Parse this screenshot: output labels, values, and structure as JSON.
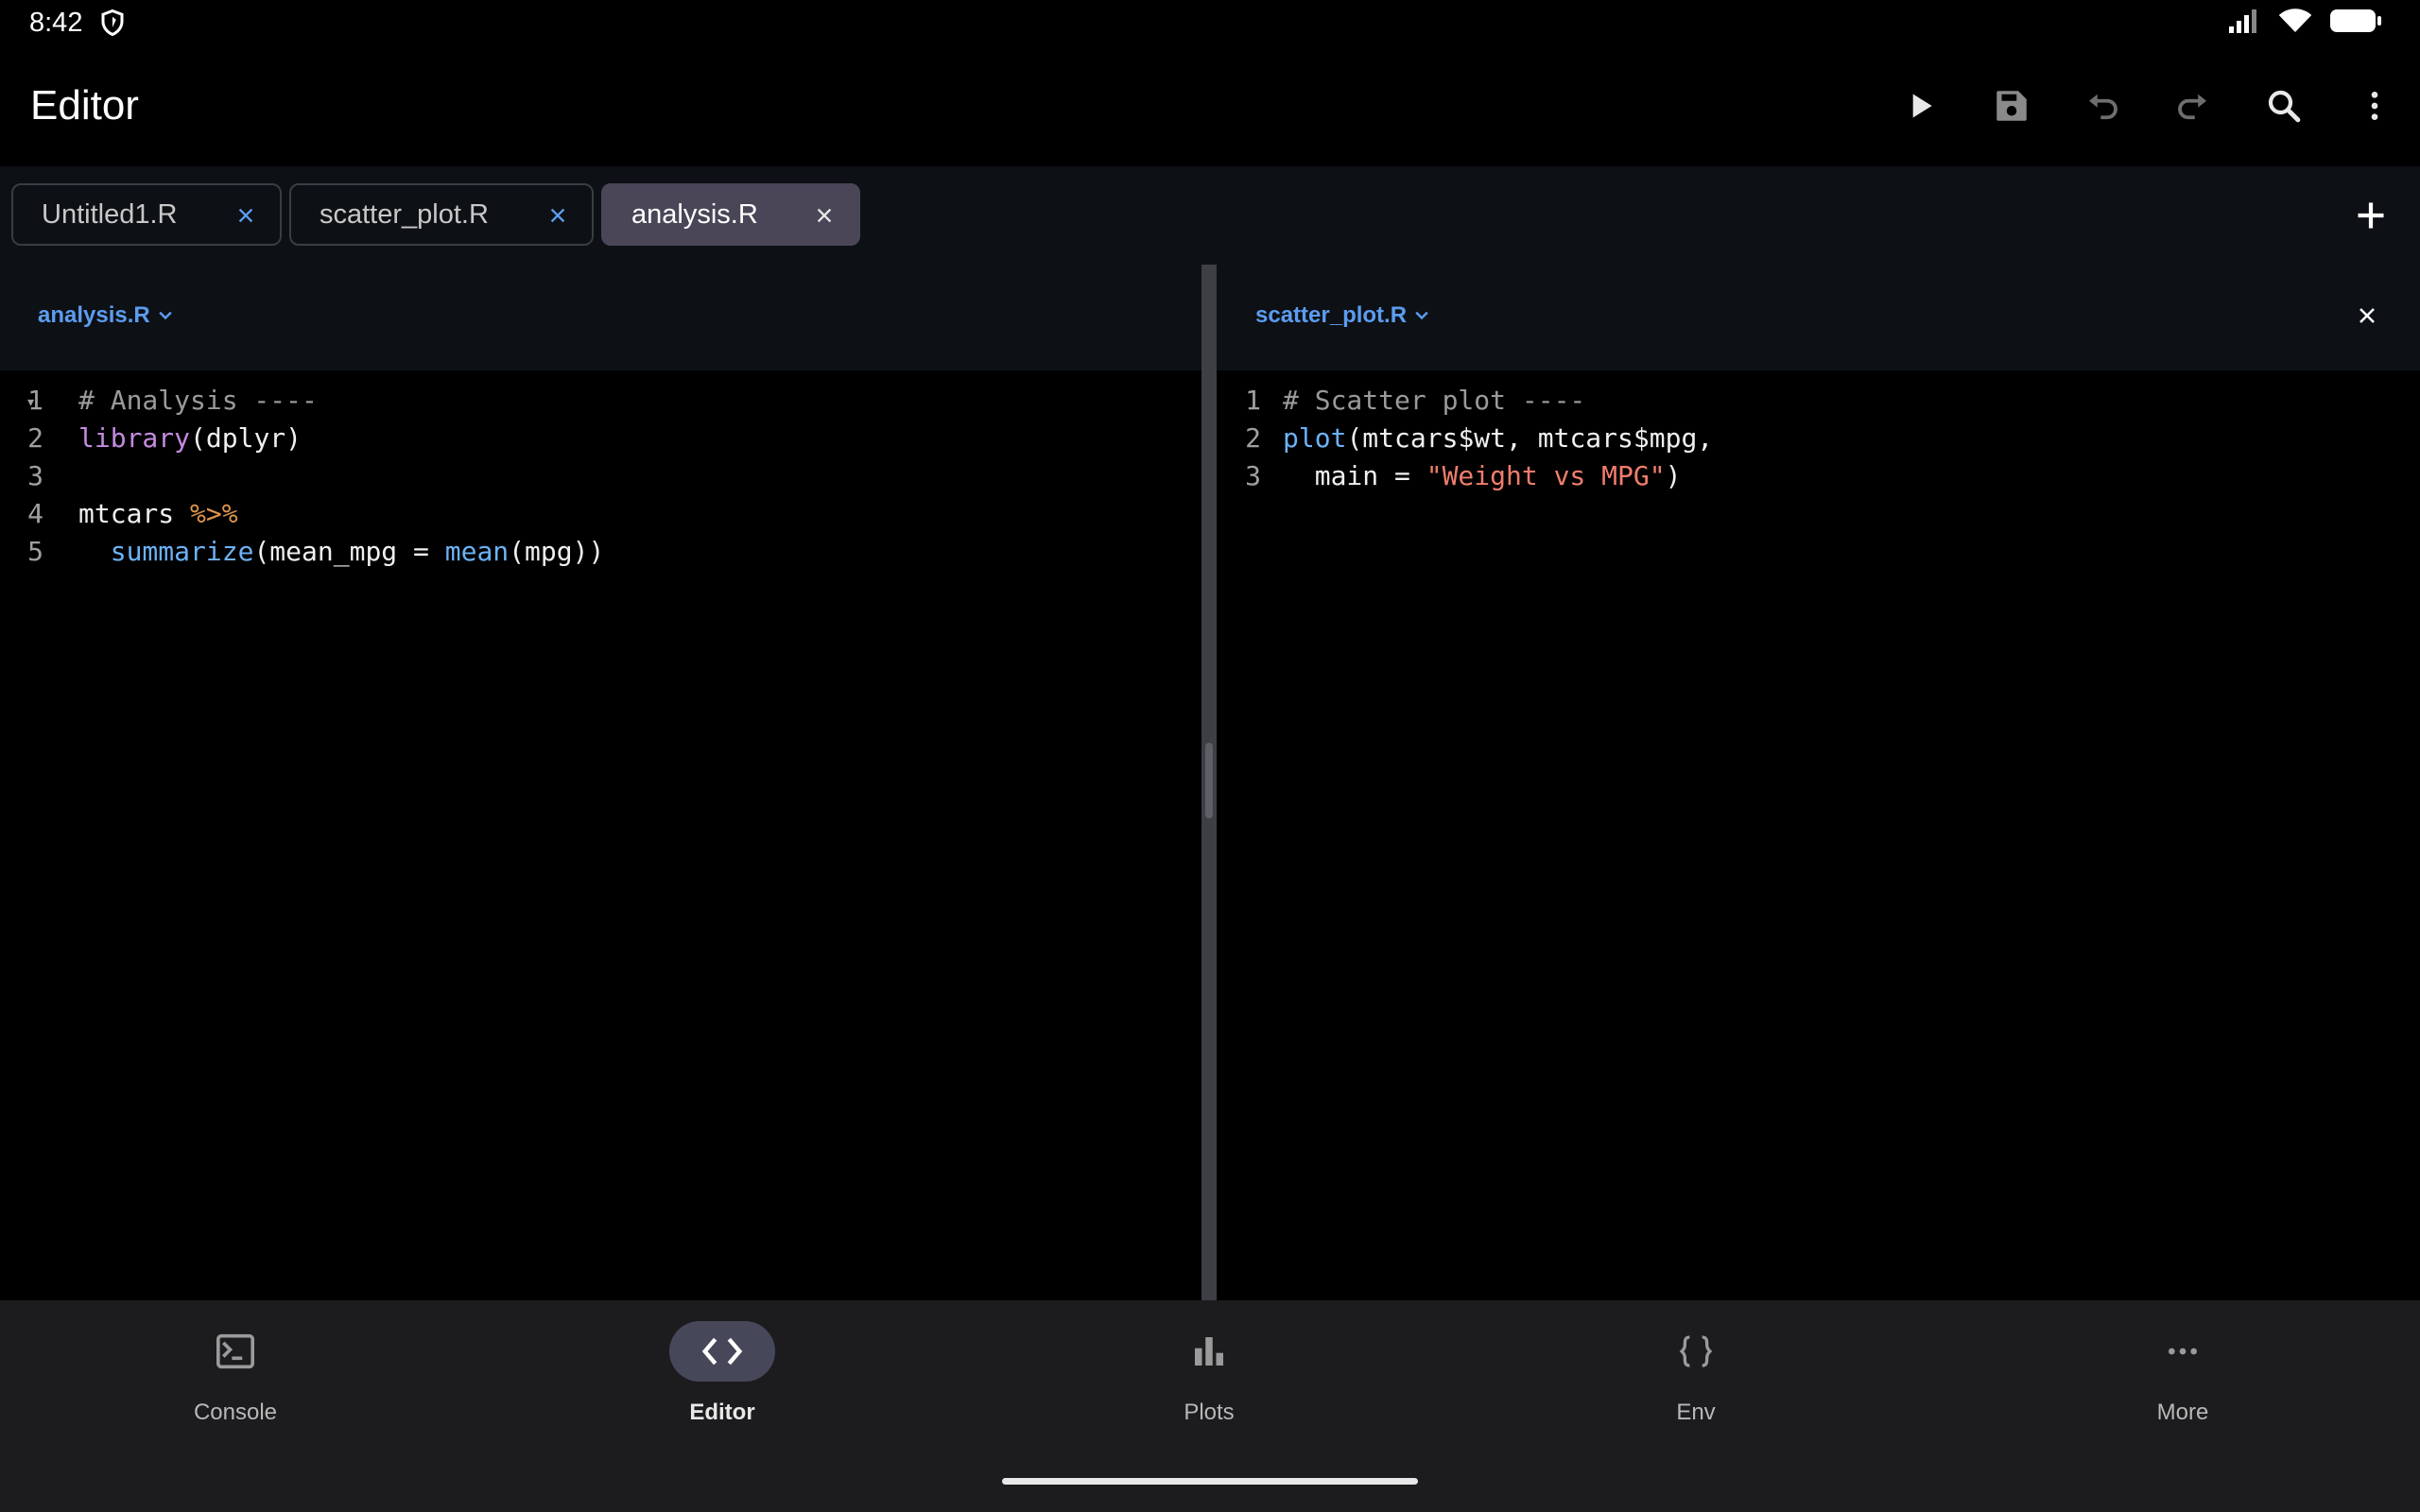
{
  "status_bar": {
    "time": "8:42"
  },
  "app_bar": {
    "title": "Editor",
    "actions": [
      "run-icon",
      "save-icon",
      "undo-icon",
      "redo-icon",
      "search-icon",
      "more-vert-icon"
    ]
  },
  "tabs": [
    {
      "label": "Untitled1.R",
      "active": false
    },
    {
      "label": "scatter_plot.R",
      "active": false
    },
    {
      "label": "analysis.R",
      "active": true
    }
  ],
  "left_pane": {
    "file": "analysis.R",
    "lines": [
      {
        "num": "1",
        "fold": true,
        "tokens": [
          {
            "t": "# Analysis ----",
            "c": "comment"
          }
        ]
      },
      {
        "num": "2",
        "tokens": [
          {
            "t": "library",
            "c": "fn-purple"
          },
          {
            "t": "(dplyr)",
            "c": "plain"
          }
        ]
      },
      {
        "num": "3",
        "tokens": []
      },
      {
        "num": "4",
        "tokens": [
          {
            "t": "mtcars ",
            "c": "plain"
          },
          {
            "t": "%>%",
            "c": "op"
          }
        ]
      },
      {
        "num": "5",
        "tokens": [
          {
            "t": "  ",
            "c": "plain"
          },
          {
            "t": "summarize",
            "c": "fn-blue"
          },
          {
            "t": "(mean_mpg = ",
            "c": "plain"
          },
          {
            "t": "mean",
            "c": "fn-blue"
          },
          {
            "t": "(mpg))",
            "c": "plain"
          }
        ]
      }
    ]
  },
  "right_pane": {
    "file": "scatter_plot.R",
    "lines": [
      {
        "num": "1",
        "tokens": [
          {
            "t": "# Scatter plot ----",
            "c": "comment"
          }
        ]
      },
      {
        "num": "2",
        "tokens": [
          {
            "t": "plot",
            "c": "fn-blue"
          },
          {
            "t": "(mtcars$wt, mtcars$mpg,",
            "c": "plain"
          }
        ]
      },
      {
        "num": "3",
        "tokens": [
          {
            "t": "  main = ",
            "c": "plain"
          },
          {
            "t": "\"Weight vs MPG\"",
            "c": "string"
          },
          {
            "t": ")",
            "c": "plain"
          }
        ]
      }
    ]
  },
  "bottom_nav": [
    {
      "label": "Console",
      "icon": "console-icon",
      "active": false
    },
    {
      "label": "Editor",
      "icon": "code-icon",
      "active": true
    },
    {
      "label": "Plots",
      "icon": "bar-chart-icon",
      "active": false
    },
    {
      "label": "Env",
      "icon": "braces-icon",
      "active": false
    },
    {
      "label": "More",
      "icon": "more-horiz-icon",
      "active": false
    }
  ],
  "colors": {
    "accent": "#5b9cf0",
    "active_tab": "#4a4658",
    "nav_active_pill": "#47475a"
  }
}
